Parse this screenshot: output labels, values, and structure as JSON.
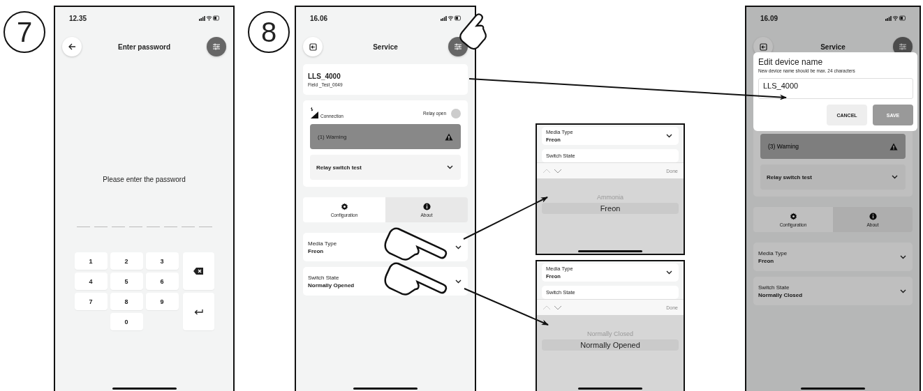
{
  "password_screen": {
    "step": "7",
    "time": "12.35",
    "title": "Enter password",
    "prompt": "Please enter the password",
    "pin_slots": [
      {
        "filled": false
      },
      {
        "filled": false
      },
      {
        "filled": false
      },
      {
        "filled": false
      },
      {
        "filled": false
      },
      {
        "filled": false
      },
      {
        "filled": false
      },
      {
        "filled": false
      }
    ],
    "keys": [
      "1",
      "2",
      "3",
      "4",
      "5",
      "6",
      "7",
      "8",
      "9",
      "0"
    ]
  },
  "service_screen": {
    "step": "8",
    "time": "16.06",
    "title": "Service",
    "device_name": "LLS_4000",
    "device_id": "Field _Test_0049",
    "connection": "Connection",
    "relay_label": "Relay open",
    "relay_on": false,
    "warning": "(1) Warning",
    "relay_test": "Relay switch test",
    "tabs": [
      {
        "label": "Configuration",
        "kind": "gear",
        "selected": true
      },
      {
        "label": "About",
        "kind": "info",
        "selected": false
      }
    ],
    "settings": [
      {
        "label": "Media Type",
        "value": "Freon"
      },
      {
        "label": "Switch State",
        "value": "Normally Opened"
      }
    ]
  },
  "pickers": [
    {
      "field_label": "Media Type",
      "field_value": "Freon",
      "partial_label": "Switch State",
      "done": "Done",
      "options": [
        {
          "label": "Ammonia",
          "selected": false
        },
        {
          "label": "Freon",
          "selected": true
        }
      ]
    },
    {
      "field_label": "Media Type",
      "field_value": "Freon",
      "partial_label": "Switch State",
      "done": "Done",
      "options": [
        {
          "label": "Normally Closed",
          "selected": false
        },
        {
          "label": "Normally Opened",
          "selected": true
        }
      ]
    }
  ],
  "edit_screen": {
    "time": "16.09",
    "title": "Service",
    "dialog": {
      "title": "Edit device name",
      "hint": "New device name should be max. 24 characters",
      "value": "LLS_4000",
      "cancel": "CANCEL",
      "save": "SAVE"
    },
    "warning": "(3) Warning",
    "relay_test": "Relay switch test",
    "tabs": [
      {
        "label": "Configuration",
        "kind": "gear",
        "selected": true
      },
      {
        "label": "About",
        "kind": "info",
        "selected": false
      }
    ],
    "settings": [
      {
        "label": "Media Type",
        "value": "Freon"
      },
      {
        "label": "Switch State",
        "value": "Normally Closed"
      }
    ]
  }
}
